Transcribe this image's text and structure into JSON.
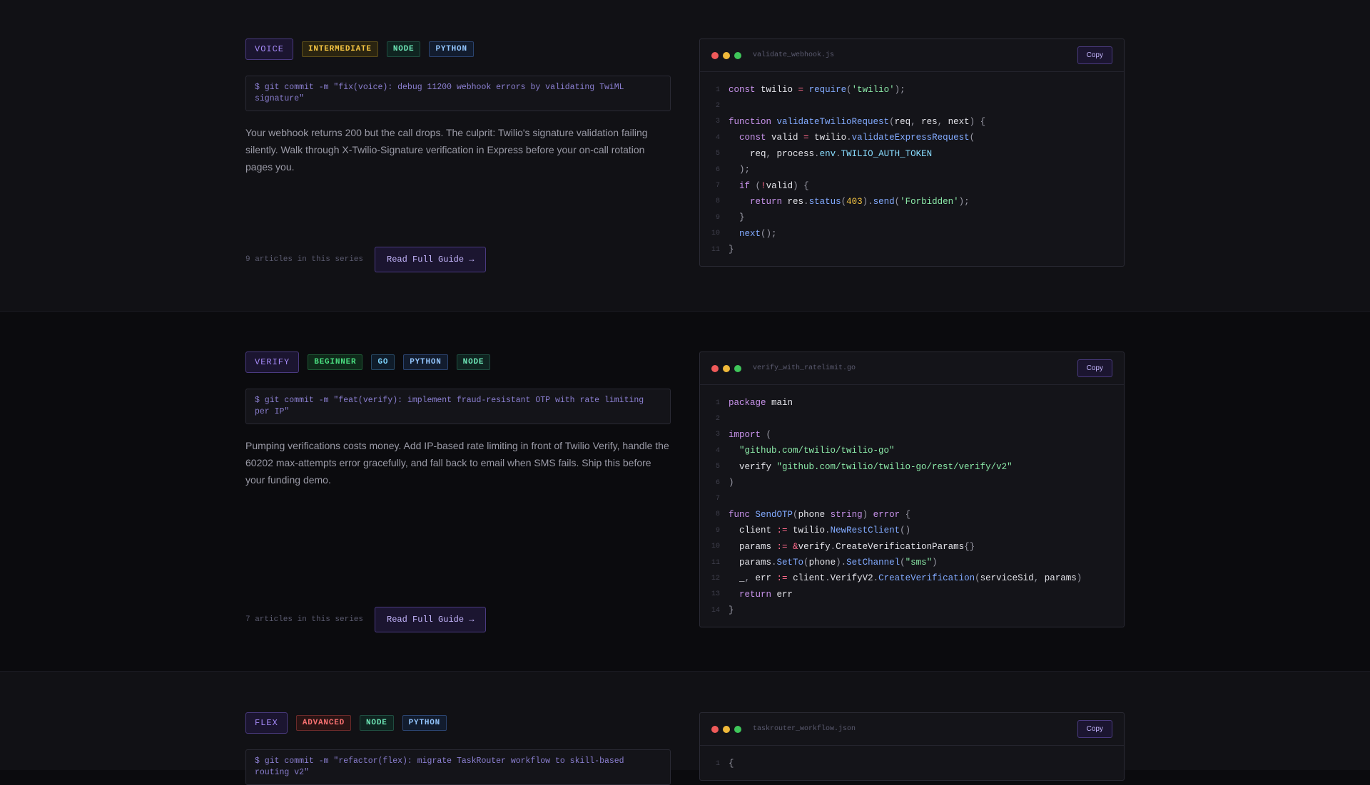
{
  "guides": [
    {
      "product": "VOICE",
      "level": "INTERMEDIATE",
      "level_key": "intermediate",
      "languages": [
        {
          "label": "NODE",
          "key": "node"
        },
        {
          "label": "PYTHON",
          "key": "python"
        }
      ],
      "commit": "$ git commit -m \"fix(voice): debug 11200 webhook errors by validating TwiML signature\"",
      "description": "Your webhook returns 200 but the call drops. The culprit: Twilio's signature validation failing silently. Walk through X-Twilio-Signature verification in Express before your on-call rotation pages you.",
      "series_count": "9 articles in this series",
      "read_label": "Read Full Guide →",
      "filename": "validate_webhook.js",
      "copy_label": "Copy",
      "code": [
        [
          [
            "kw",
            "const"
          ],
          [
            "src",
            " twilio "
          ],
          [
            "op",
            "="
          ],
          [
            "src",
            " "
          ],
          [
            "fn",
            "require"
          ],
          [
            "pn",
            "("
          ],
          [
            "str",
            "'twilio'"
          ],
          [
            "pn",
            ");"
          ]
        ],
        [],
        [
          [
            "kw",
            "function"
          ],
          [
            "src",
            " "
          ],
          [
            "fn",
            "validateTwilioRequest"
          ],
          [
            "pn",
            "("
          ],
          [
            "src",
            "req"
          ],
          [
            "pn",
            ", "
          ],
          [
            "src",
            "res"
          ],
          [
            "pn",
            ", "
          ],
          [
            "src",
            "next"
          ],
          [
            "pn",
            ") {"
          ]
        ],
        [
          [
            "src",
            "  "
          ],
          [
            "kw",
            "const"
          ],
          [
            "src",
            " valid "
          ],
          [
            "op",
            "="
          ],
          [
            "src",
            " twilio"
          ],
          [
            "pn",
            "."
          ],
          [
            "fn",
            "validateExpressRequest"
          ],
          [
            "pn",
            "("
          ]
        ],
        [
          [
            "src",
            "    req"
          ],
          [
            "pn",
            ", "
          ],
          [
            "src",
            "process"
          ],
          [
            "pn",
            "."
          ],
          [
            "const",
            "env"
          ],
          [
            "pn",
            "."
          ],
          [
            "const",
            "TWILIO_AUTH_TOKEN"
          ]
        ],
        [
          [
            "pn",
            "  );"
          ]
        ],
        [
          [
            "src",
            "  "
          ],
          [
            "kw",
            "if"
          ],
          [
            "pn",
            " ("
          ],
          [
            "op",
            "!"
          ],
          [
            "src",
            "valid"
          ],
          [
            "pn",
            ") {"
          ]
        ],
        [
          [
            "src",
            "    "
          ],
          [
            "kw",
            "return"
          ],
          [
            "src",
            " res"
          ],
          [
            "pn",
            "."
          ],
          [
            "fn",
            "status"
          ],
          [
            "pn",
            "("
          ],
          [
            "num",
            "403"
          ],
          [
            "pn",
            ")."
          ],
          [
            "fn",
            "send"
          ],
          [
            "pn",
            "("
          ],
          [
            "str",
            "'Forbidden'"
          ],
          [
            "pn",
            ");"
          ]
        ],
        [
          [
            "pn",
            "  }"
          ]
        ],
        [
          [
            "src",
            "  "
          ],
          [
            "fn",
            "next"
          ],
          [
            "pn",
            "();"
          ]
        ],
        [
          [
            "pn",
            "}"
          ]
        ]
      ]
    },
    {
      "product": "VERIFY",
      "level": "BEGINNER",
      "level_key": "beginner",
      "languages": [
        {
          "label": "GO",
          "key": "go"
        },
        {
          "label": "PYTHON",
          "key": "python"
        },
        {
          "label": "NODE",
          "key": "node"
        }
      ],
      "commit": "$ git commit -m \"feat(verify): implement fraud-resistant OTP with rate limiting per IP\"",
      "description": "Pumping verifications costs money. Add IP-based rate limiting in front of Twilio Verify, handle the 60202 max-attempts error gracefully, and fall back to email when SMS fails. Ship this before your funding demo.",
      "series_count": "7 articles in this series",
      "read_label": "Read Full Guide →",
      "filename": "verify_with_ratelimit.go",
      "copy_label": "Copy",
      "code": [
        [
          [
            "kw",
            "package"
          ],
          [
            "src",
            " main"
          ]
        ],
        [],
        [
          [
            "kw",
            "import"
          ],
          [
            "pn",
            " ("
          ]
        ],
        [
          [
            "src",
            "  "
          ],
          [
            "str",
            "\"github.com/twilio/twilio-go\""
          ]
        ],
        [
          [
            "src",
            "  verify "
          ],
          [
            "str",
            "\"github.com/twilio/twilio-go/rest/verify/v2\""
          ]
        ],
        [
          [
            "pn",
            ")"
          ]
        ],
        [],
        [
          [
            "kw",
            "func"
          ],
          [
            "src",
            " "
          ],
          [
            "fn",
            "SendOTP"
          ],
          [
            "pn",
            "("
          ],
          [
            "src",
            "phone "
          ],
          [
            "kw",
            "string"
          ],
          [
            "pn",
            ") "
          ],
          [
            "kw",
            "error"
          ],
          [
            "pn",
            " {"
          ]
        ],
        [
          [
            "src",
            "  client "
          ],
          [
            "op",
            ":="
          ],
          [
            "src",
            " twilio"
          ],
          [
            "pn",
            "."
          ],
          [
            "fn",
            "NewRestClient"
          ],
          [
            "pn",
            "()"
          ]
        ],
        [
          [
            "src",
            "  params "
          ],
          [
            "op",
            ":="
          ],
          [
            "src",
            " "
          ],
          [
            "op",
            "&"
          ],
          [
            "src",
            "verify"
          ],
          [
            "pn",
            "."
          ],
          [
            "src",
            "CreateVerificationParams"
          ],
          [
            "pn",
            "{}"
          ]
        ],
        [
          [
            "src",
            "  params"
          ],
          [
            "pn",
            "."
          ],
          [
            "fn",
            "SetTo"
          ],
          [
            "pn",
            "("
          ],
          [
            "src",
            "phone"
          ],
          [
            "pn",
            ")."
          ],
          [
            "fn",
            "SetChannel"
          ],
          [
            "pn",
            "("
          ],
          [
            "str",
            "\"sms\""
          ],
          [
            "pn",
            ")"
          ]
        ],
        [
          [
            "src",
            "  _"
          ],
          [
            "pn",
            ", "
          ],
          [
            "src",
            "err "
          ],
          [
            "op",
            ":="
          ],
          [
            "src",
            " client"
          ],
          [
            "pn",
            "."
          ],
          [
            "src",
            "VerifyV2"
          ],
          [
            "pn",
            "."
          ],
          [
            "fn",
            "CreateVerification"
          ],
          [
            "pn",
            "("
          ],
          [
            "src",
            "serviceSid"
          ],
          [
            "pn",
            ", "
          ],
          [
            "src",
            "params"
          ],
          [
            "pn",
            ")"
          ]
        ],
        [
          [
            "src",
            "  "
          ],
          [
            "kw",
            "return"
          ],
          [
            "src",
            " err"
          ]
        ],
        [
          [
            "pn",
            "}"
          ]
        ]
      ]
    },
    {
      "product": "FLEX",
      "level": "ADVANCED",
      "level_key": "advanced",
      "languages": [
        {
          "label": "NODE",
          "key": "node"
        },
        {
          "label": "PYTHON",
          "key": "python"
        }
      ],
      "commit": "$ git commit -m \"refactor(flex): migrate TaskRouter workflow to skill-based routing v2\"",
      "description": "",
      "series_count": "",
      "read_label": "",
      "filename": "taskrouter_workflow.json",
      "copy_label": "Copy",
      "code": [
        [
          [
            "pn",
            "{"
          ]
        ]
      ]
    }
  ],
  "colors": {
    "accent": "#a78bfa",
    "background": "#0b0b0e",
    "background_alt": "#111115"
  }
}
